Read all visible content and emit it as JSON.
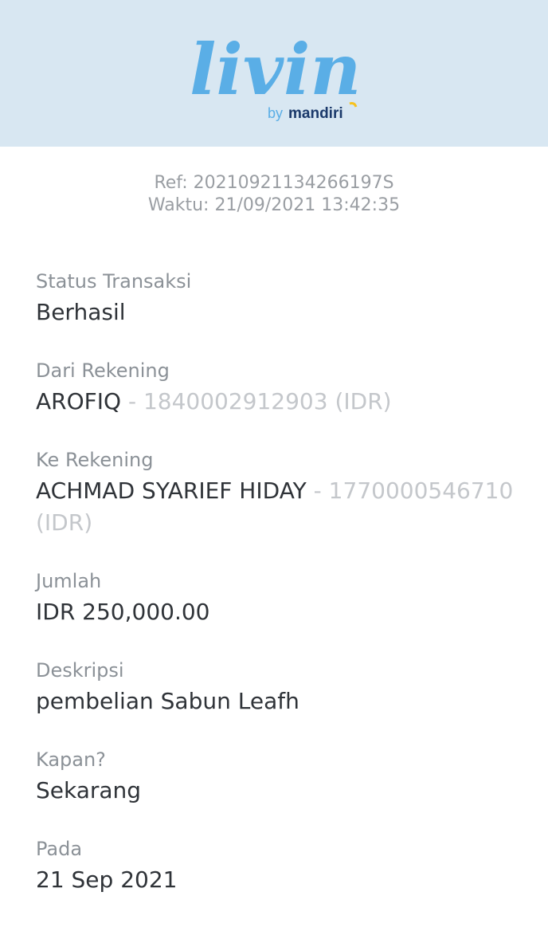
{
  "brand": {
    "logo_text": "livin'",
    "by_text": "by",
    "bank_text": "mandiri",
    "colors": {
      "header_bg": "#d8e7f2",
      "logo_blue": "#5aaee6",
      "logo_yellow": "#f7c21c",
      "bank_navy": "#1b3a6b"
    }
  },
  "reference": {
    "ref_line": "Ref: 20210921134266197S",
    "time_line": "Waktu: 21/09/2021 13:42:35"
  },
  "fields": {
    "status": {
      "label": "Status Transaksi",
      "value": "Berhasil"
    },
    "from_account": {
      "label": "Dari Rekening",
      "name": "AROFIQ",
      "detail": " - 1840002912903 (IDR)"
    },
    "to_account": {
      "label": "Ke Rekening",
      "name": "ACHMAD SYARIEF HIDAY",
      "detail": " - 1770000546710 (IDR)"
    },
    "amount": {
      "label": "Jumlah",
      "value": "IDR 250,000.00"
    },
    "description": {
      "label": "Deskripsi",
      "value": "pembelian Sabun Leafh"
    },
    "when": {
      "label": "Kapan?",
      "value": "Sekarang"
    },
    "date": {
      "label": "Pada",
      "value": "21 Sep 2021"
    }
  }
}
